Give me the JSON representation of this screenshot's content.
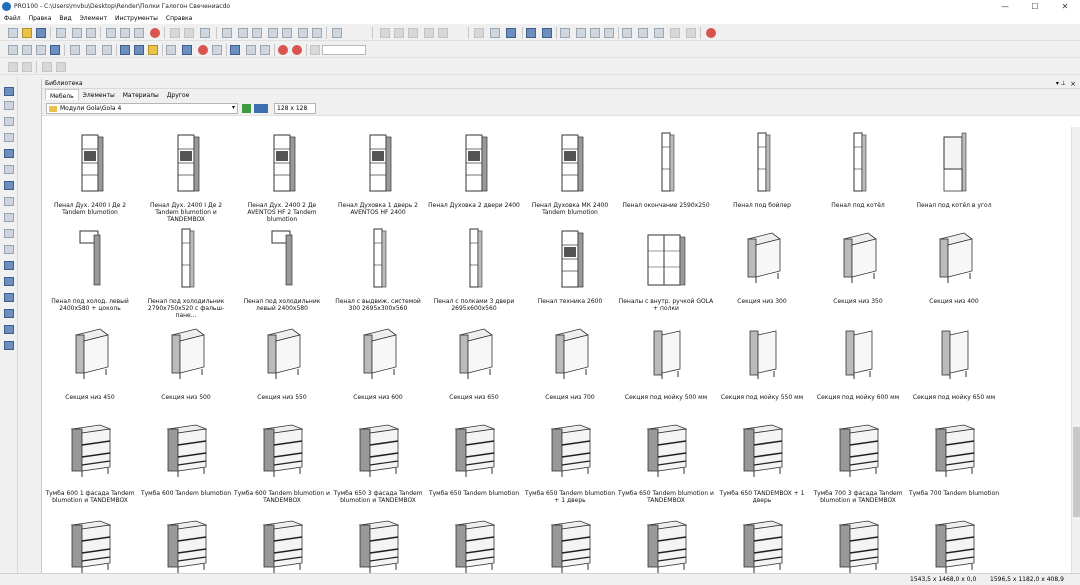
{
  "window": {
    "title": "PRO100 - C:\\Users\\mvbu\\Desktop\\Render\\Полки Галогон Свечениасdo",
    "minimize": "—",
    "maximize": "☐",
    "close": "✕"
  },
  "menu": [
    "Файл",
    "Правка",
    "Вид",
    "Элемент",
    "Инструменты",
    "Справка"
  ],
  "library": {
    "title": "Библиотека",
    "pin": "▾ ⊥",
    "close": "×",
    "tabs": [
      "Мебель",
      "Элементы",
      "Материалы",
      "Другое"
    ],
    "active_tab": 0,
    "path": "Модули Gola\\Gola 4",
    "thumb_size": "128 x 128"
  },
  "items": [
    {
      "label": "Пенал Дух. 2400 І Де 2 Tandem blumotion",
      "kind": "tall"
    },
    {
      "label": "Пенал Дух. 2400 І Де 2 Tandem blumotion и TANDEMBOX",
      "kind": "tall"
    },
    {
      "label": "Пенал Дух. 2400 2 Де AVENTOS HF 2 Tandem blumotion",
      "kind": "tall"
    },
    {
      "label": "Пенал Духовка 1 дверь 2 AVENTOS HF 2400",
      "kind": "tall"
    },
    {
      "label": "Пенал Духовка 2 двери 2400",
      "kind": "tall"
    },
    {
      "label": "Пенал Духовка МК 2400 Tandem blumotion",
      "kind": "tall"
    },
    {
      "label": "Пенал окончание 2590х250",
      "kind": "slim"
    },
    {
      "label": "Пенал под бойлер",
      "kind": "slim"
    },
    {
      "label": "Пенал под котёл",
      "kind": "slim"
    },
    {
      "label": "Пенал под котёл в угол",
      "kind": "corner"
    },
    {
      "label": "Пенал под холод. левый 2400х580 + цоколь",
      "kind": "panel"
    },
    {
      "label": "Пенал под холодильник 2790х750х520 с фальш-пане...",
      "kind": "slim"
    },
    {
      "label": "Пенал под холодильник левый 2400х580",
      "kind": "panel"
    },
    {
      "label": "Пенал с выдвиж. системой 300 2695х300х560",
      "kind": "slim"
    },
    {
      "label": "Пенал с полками 3 двери 2695х600х560",
      "kind": "slim"
    },
    {
      "label": "Пенал техника 2600",
      "kind": "tall"
    },
    {
      "label": "Пеналы с внутр. ручкой GOLA + полки",
      "kind": "double"
    },
    {
      "label": "Секция низ 300",
      "kind": "base"
    },
    {
      "label": "Секция низ 350",
      "kind": "base"
    },
    {
      "label": "Секция низ 400",
      "kind": "base"
    },
    {
      "label": "Секция низ 450",
      "kind": "base"
    },
    {
      "label": "Секция низ 500",
      "kind": "base"
    },
    {
      "label": "Секция низ 550",
      "kind": "base"
    },
    {
      "label": "Секция низ 600",
      "kind": "base"
    },
    {
      "label": "Секция низ 650",
      "kind": "base"
    },
    {
      "label": "Секция низ 700",
      "kind": "base"
    },
    {
      "label": "Секция под мойку 500 мм",
      "kind": "sink"
    },
    {
      "label": "Секция под мойку 550 мм",
      "kind": "sink"
    },
    {
      "label": "Секция под мойку 600 мм",
      "kind": "sink"
    },
    {
      "label": "Секция под мойку 650 мм",
      "kind": "sink"
    },
    {
      "label": "Тумба 600 1 фасада Tandem blumotion и TANDEMBOX",
      "kind": "drawers"
    },
    {
      "label": "Тумба 600 Tandem blumotion",
      "kind": "drawers"
    },
    {
      "label": "Тумба 600 Tandem blumotion и TANDEMBOX",
      "kind": "drawers"
    },
    {
      "label": "Тумба 650 3 фасада Tandem blumotion и TANDEMBOX",
      "kind": "drawers"
    },
    {
      "label": "Тумба 650 Tandem blumotion",
      "kind": "drawers"
    },
    {
      "label": "Тумба 650 Tandem blumotion + 1 дверь",
      "kind": "drawers"
    },
    {
      "label": "Тумба 650 Tandem blumotion и TANDEMBOX",
      "kind": "drawers"
    },
    {
      "label": "Тумба 650 TANDEMBOX + 1 дверь",
      "kind": "drawers"
    },
    {
      "label": "Тумба 700 3 фасада Tandem blumotion и TANDEMBOX",
      "kind": "drawers"
    },
    {
      "label": "Тумба 700 Tandem blumotion",
      "kind": "drawers"
    },
    {
      "label": "",
      "kind": "drawers"
    },
    {
      "label": "",
      "kind": "drawers"
    },
    {
      "label": "",
      "kind": "drawers"
    },
    {
      "label": "",
      "kind": "drawers"
    },
    {
      "label": "",
      "kind": "drawers"
    },
    {
      "label": "",
      "kind": "drawers"
    },
    {
      "label": "",
      "kind": "drawers"
    },
    {
      "label": "",
      "kind": "drawers"
    },
    {
      "label": "",
      "kind": "drawers"
    },
    {
      "label": "",
      "kind": "drawers"
    }
  ],
  "status": {
    "coords1": "1543,5 x 1468,0 x 0,0",
    "coords2": "1596,5 x 1182,0 x 408,9"
  }
}
